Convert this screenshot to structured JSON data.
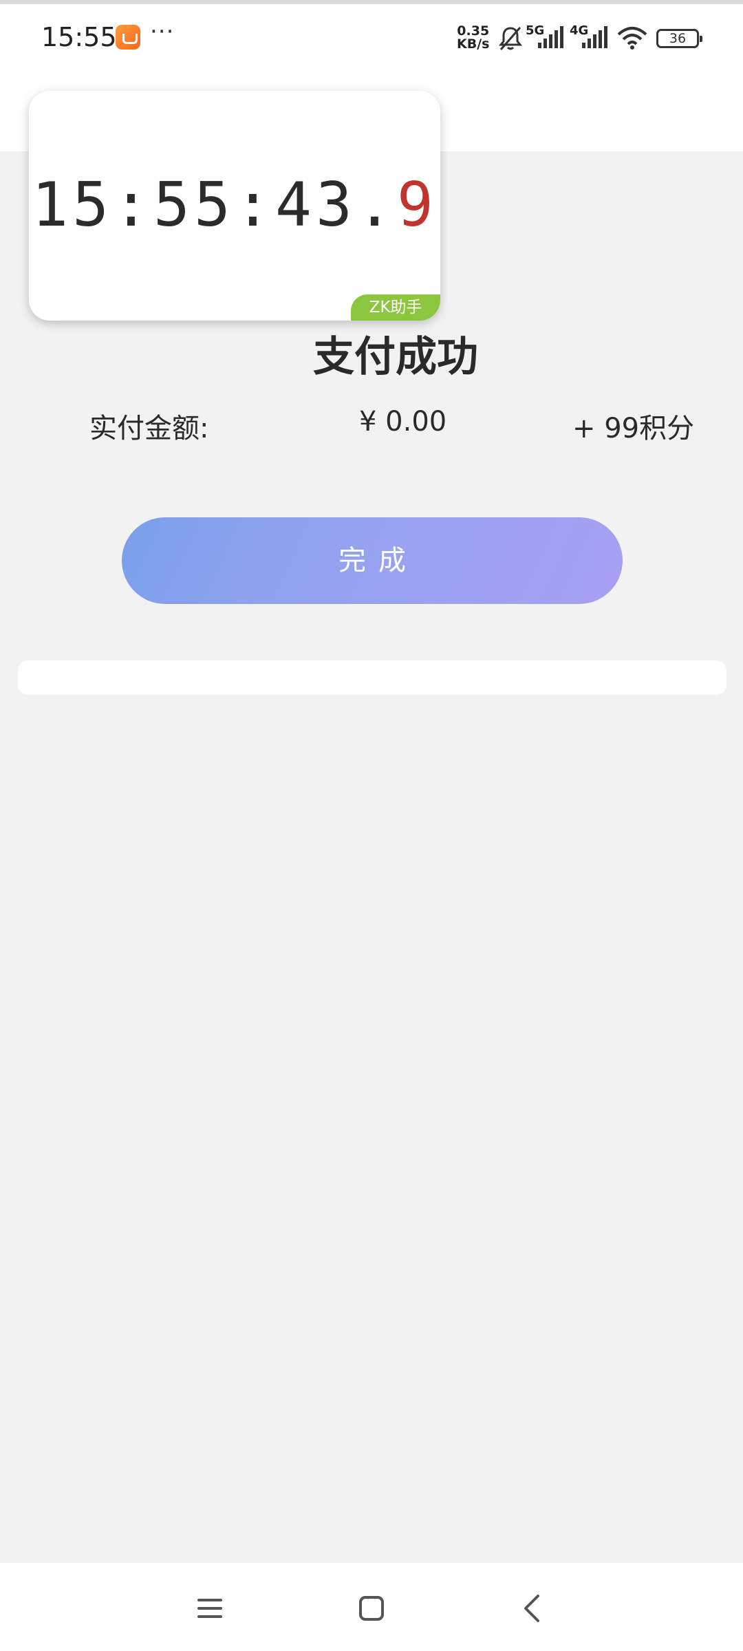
{
  "status_bar": {
    "time": "15:55",
    "more": "···",
    "net_speed_value": "0.35",
    "net_speed_unit": "KB/s",
    "signal_1_label": "5G",
    "signal_2_label": "4G",
    "battery": "36",
    "icons": [
      "shopping-app-icon",
      "mute-icon",
      "signal-5g-icon",
      "signal-4g-icon",
      "wifi-icon",
      "battery-icon"
    ]
  },
  "clock_widget": {
    "time_main": "15:55:43.",
    "time_fraction": "9",
    "badge": "ZK助手",
    "colors": {
      "fraction": "#c0342f",
      "badge": "#8cc63f"
    }
  },
  "result": {
    "title": "支付成功",
    "amount_label": "实付金额:",
    "amount_value": "¥ 0.00",
    "points": "+ 99积分"
  },
  "actions": {
    "done_label": "完成",
    "gradient_colors": [
      "#7b9fec",
      "#a7a0f3"
    ]
  },
  "nav_bar": {
    "icons": [
      "menu-icon",
      "home-icon",
      "back-icon"
    ]
  }
}
